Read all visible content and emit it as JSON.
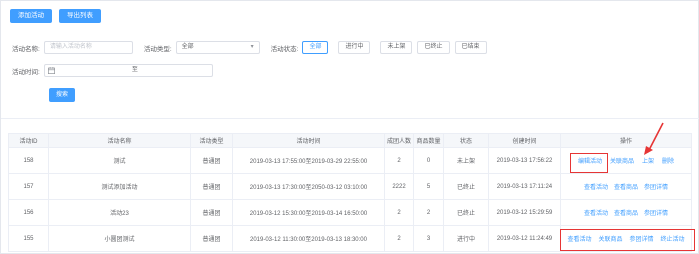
{
  "toolbar": {
    "add_label": "添加活动",
    "export_label": "导出列表"
  },
  "filters": {
    "name_label": "活动名称:",
    "name_placeholder": "请输入活动名称",
    "type_label": "活动类型:",
    "type_value": "全部",
    "status_label": "活动状态:",
    "statuses": [
      "全部",
      "进行中",
      "未上架",
      "已终止",
      "已结束"
    ],
    "time_label": "活动时间:",
    "range_separator": "至",
    "search_label": "搜索"
  },
  "table": {
    "headers": [
      "活动ID",
      "活动名称",
      "活动类型",
      "活动时间",
      "成团人数",
      "商品数量",
      "状态",
      "创建时间",
      "操作"
    ],
    "rows": [
      {
        "id": "158",
        "name": "测试",
        "type": "普通团",
        "time": "2019-03-13 17:55:00至2019-03-29 22:55:00",
        "people": "2",
        "goods": "0",
        "status": "未上架",
        "created": "2019-03-13 17:56:22",
        "ops": [
          "编辑活动",
          "关联商品",
          "上架",
          "删除"
        ]
      },
      {
        "id": "157",
        "name": "测试添加活动",
        "type": "普通团",
        "time": "2019-03-13 17:30:00至2050-03-12 03:10:00",
        "people": "2222",
        "goods": "5",
        "status": "已终止",
        "created": "2019-03-13 17:11:24",
        "ops": [
          "查看活动",
          "查看商品",
          "参团详情"
        ]
      },
      {
        "id": "156",
        "name": "活动23",
        "type": "普通团",
        "time": "2019-03-12 15:30:00至2019-03-14 16:50:00",
        "people": "2",
        "goods": "2",
        "status": "已终止",
        "created": "2019-03-12 15:29:59",
        "ops": [
          "查看活动",
          "查看商品",
          "参团详情"
        ]
      },
      {
        "id": "155",
        "name": "小圆团测试",
        "type": "普通团",
        "time": "2019-03-12 11:30:00至2019-03-13 18:30:00",
        "people": "2",
        "goods": "3",
        "status": "进行中",
        "created": "2019-03-12 11:24:49",
        "ops": [
          "查看活动",
          "关联商品",
          "参团详情",
          "终止活动"
        ]
      }
    ]
  },
  "colors": {
    "primary": "#409eff",
    "highlight": "#e63535"
  },
  "icons": {
    "date": "calendar-icon",
    "select": "chevron-down-icon"
  }
}
